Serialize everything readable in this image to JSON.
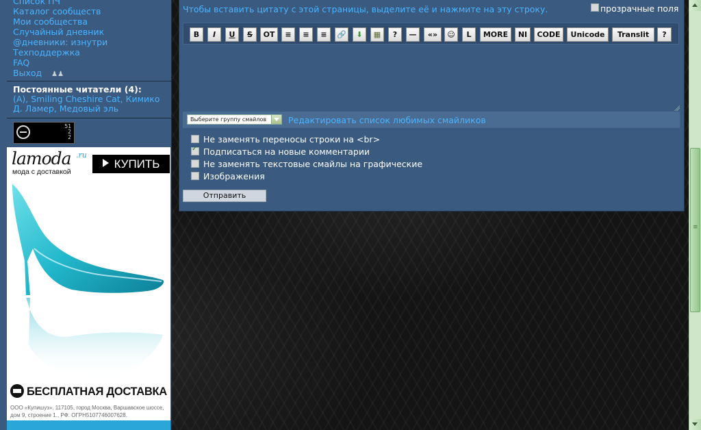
{
  "sidebar": {
    "nav": [
      "Список ПЧ",
      "Каталог сообществ",
      "Мои сообщества",
      "Случайный дневник",
      "@дневники: изнутри",
      "Техподдержка",
      "FAQ",
      "Выход"
    ],
    "readers_title": "Постоянные читатели (4):",
    "readers_list": "(A), Smiling Cheshire Cat, Кимико Д. Ламер, Медовый эль",
    "counter_text": "51\n2\n2"
  },
  "ad": {
    "logo": "lamoda",
    "logo_suffix": ".ru",
    "tagline": "мода с доставкой",
    "buy_label": "КУПИТЬ",
    "delivery": "БЕСПЛАТНАЯ ДОСТАВКА",
    "legal": "ООО «Купишуз». 117105, город Москва, Варшавское шоссе, дом 9, строение 1., РФ. ОГРН5107746007628."
  },
  "main": {
    "hint": "Чтобы вставить цитату с этой страницы, выделите её и нажмите на эту строку.",
    "transparent_label": "прозрачные поля",
    "toolbar": [
      "B",
      "I",
      "U",
      "S",
      "OT",
      "≡",
      "≡",
      "≡",
      "🔗",
      "⬇",
      "▦",
      "?",
      "—",
      "«»",
      "☺",
      "L",
      "MORE",
      "NI",
      "CODE",
      "Unicode",
      "Translit",
      "?"
    ],
    "smiley_select": "Выберите группу смайлов",
    "smiley_link": "Редактировать список любимых смайликов",
    "options": [
      {
        "label": "Не заменять переносы строки на <br>",
        "checked": false
      },
      {
        "label": "Подписаться на новые комментарии",
        "checked": true
      },
      {
        "label": "Не заменять текстовые смайлы на графические",
        "checked": false
      },
      {
        "label": "Изображения",
        "checked": false
      }
    ],
    "submit_label": "Отправить"
  },
  "colors": {
    "panel": "#3b5a80",
    "link": "#4ab4ff",
    "ad_accent": "#2aa7d8"
  }
}
